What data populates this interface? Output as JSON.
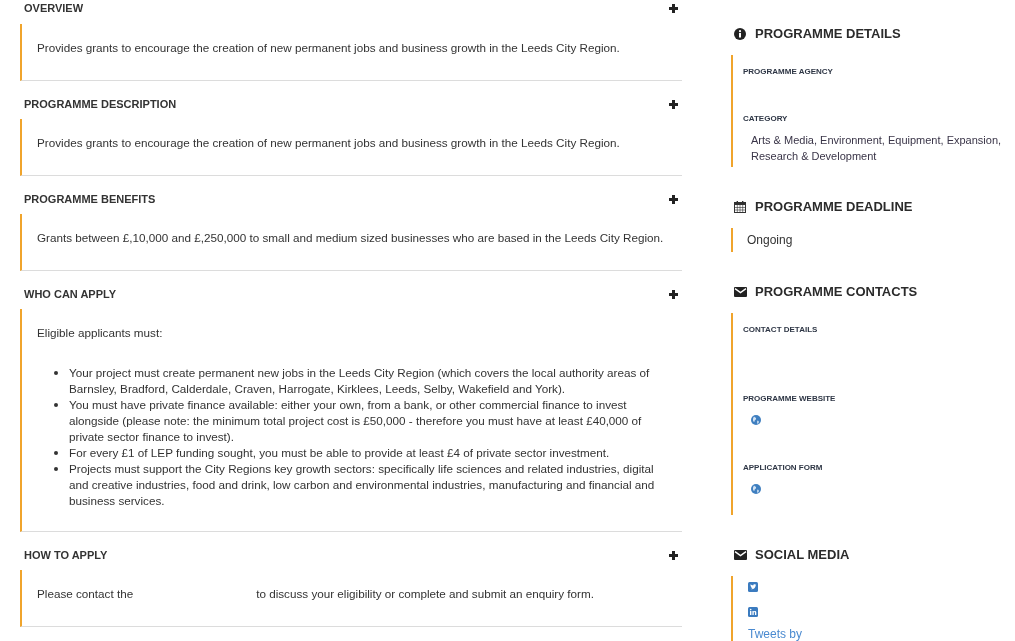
{
  "main_sections": [
    {
      "title": "OVERVIEW",
      "kind": "text",
      "text": "Provides grants to encourage the creation of new permanent jobs and business growth in the Leeds City Region."
    },
    {
      "title": "PROGRAMME DESCRIPTION",
      "kind": "text",
      "text": "Provides grants to encourage the creation of new permanent jobs and business growth in the Leeds City Region."
    },
    {
      "title": "PROGRAMME BENEFITS",
      "kind": "text",
      "text": "Grants between £,10,000 and £,250,000 to small and medium sized businesses who are based in the Leeds City Region."
    },
    {
      "title": "WHO CAN APPLY",
      "kind": "list",
      "text": "Eligible applicants must:",
      "bullets": [
        "Your project must create permanent new jobs in the Leeds City Region (which covers the local authority areas of Barnsley, Bradford, Calderdale, Craven, Harrogate, Kirklees, Leeds, Selby, Wakefield and York).",
        "You must have private finance available: either your own, from a bank, or other commercial finance to invest alongside (please note: the minimum total project cost is £50,000 - therefore you must have at least £40,000 of private sector finance to invest).",
        "For every £1 of LEP funding sought, you must be able to provide at least £4 of private sector investment.",
        "Projects must support the City Regions key growth sectors: specifically life sciences and related industries, digital and creative industries, food and drink, low carbon and environmental industries, manufacturing and financial and business services."
      ]
    },
    {
      "title": "HOW TO APPLY",
      "kind": "split",
      "text_parts": [
        "Please contact the",
        "to discuss your eligibility or complete and submit an enquiry form."
      ]
    }
  ],
  "sidebar": [
    {
      "kind": "details",
      "title": "PROGRAMME DETAILS",
      "fields": [
        {
          "label": "PROGRAMME AGENCY",
          "kind": "text"
        },
        {
          "label": "CATEGORY",
          "kind": "text",
          "value": "Arts & Media, Environment, Equipment, Expansion, Research & Development"
        }
      ]
    },
    {
      "kind": "deadline",
      "title": "PROGRAMME DEADLINE",
      "value": "Ongoing"
    },
    {
      "kind": "contacts",
      "title": "PROGRAMME CONTACTS",
      "fields": [
        {
          "label": "CONTACT DETAILS",
          "kind": "text"
        },
        {
          "label": "PROGRAMME WEBSITE",
          "kind": "link"
        },
        {
          "label": "APPLICATION FORM",
          "kind": "link"
        }
      ]
    },
    {
      "kind": "social",
      "title": "SOCIAL MEDIA",
      "links": [
        {
          "kind": "twitter"
        },
        {
          "kind": "linkedin"
        }
      ],
      "feed_text": "Tweets by"
    }
  ]
}
